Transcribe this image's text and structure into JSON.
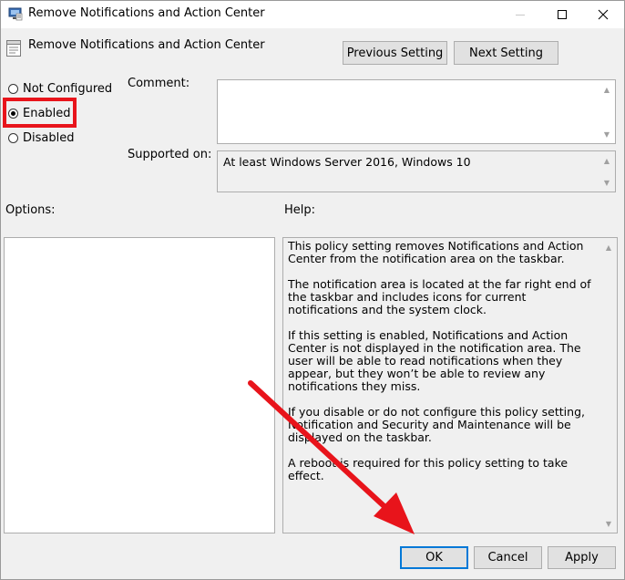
{
  "window": {
    "title": "Remove Notifications and Action Center",
    "icon": "group-policy-icon",
    "caption_buttons": [
      "minimize",
      "maximize",
      "close"
    ]
  },
  "header": {
    "setting_title": "Remove Notifications and Action Center",
    "setting_icon": "policy-setting-icon",
    "previous_label": "Previous Setting",
    "next_label": "Next Setting"
  },
  "state": {
    "options": [
      {
        "label": "Not Configured",
        "selected": false
      },
      {
        "label": "Enabled",
        "selected": true
      },
      {
        "label": "Disabled",
        "selected": false
      }
    ]
  },
  "comment": {
    "label": "Comment:",
    "value": ""
  },
  "supported": {
    "label": "Supported on:",
    "value": "At least Windows Server 2016, Windows 10"
  },
  "options_label": "Options:",
  "help": {
    "label": "Help:",
    "paragraphs": [
      "This policy setting removes Notifications and Action Center from the notification area on the taskbar.",
      "The notification area is located at the far right end of the taskbar and includes icons for current notifications and the system clock.",
      "If this setting is enabled, Notifications and Action Center is not displayed in the notification area. The user will be able to read notifications when they appear, but they won’t be able to review any notifications they miss.",
      "If you disable or do not configure this policy setting, Notification and Security and Maintenance will be displayed on the taskbar.",
      "A reboot is required for this policy setting to take effect."
    ]
  },
  "footer": {
    "ok_label": "OK",
    "cancel_label": "Cancel",
    "apply_label": "Apply"
  },
  "annotation": {
    "highlight_color": "#e8141b",
    "arrow_color": "#e8141b"
  }
}
